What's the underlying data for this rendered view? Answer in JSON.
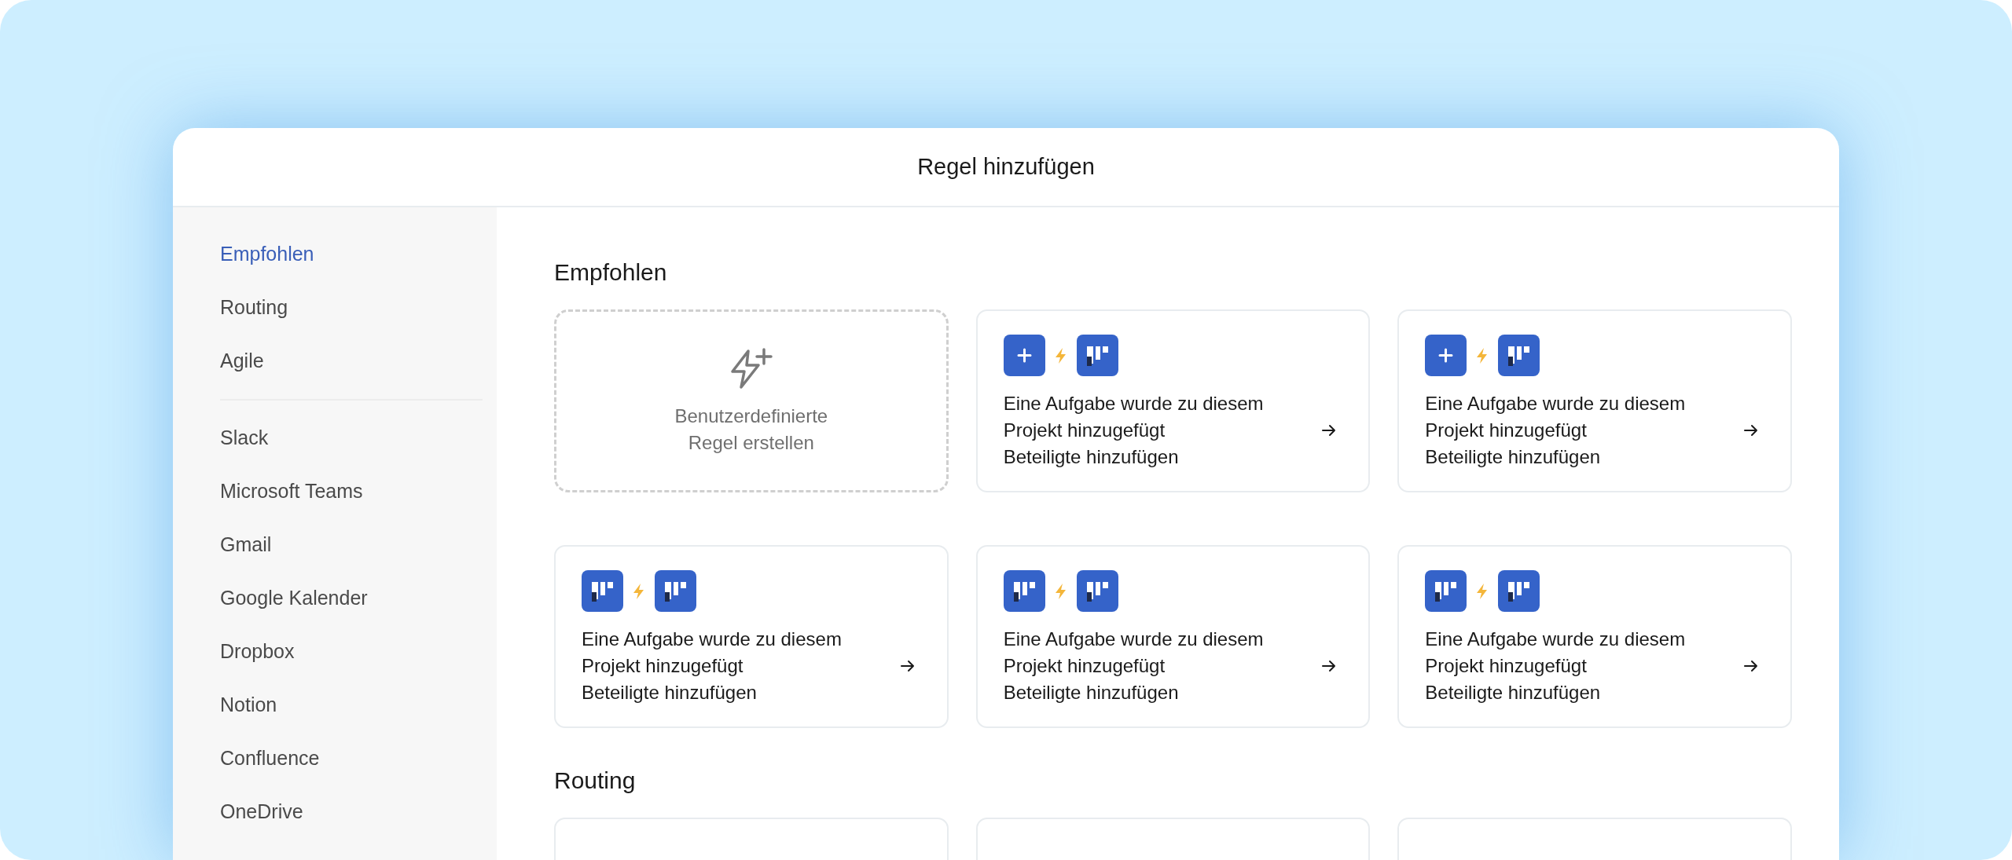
{
  "window": {
    "title": "Regel hinzufügen"
  },
  "sidebar": {
    "groups": [
      {
        "items": [
          {
            "label": "Empfohlen",
            "selected": true
          },
          {
            "label": "Routing",
            "selected": false
          },
          {
            "label": "Agile",
            "selected": false
          }
        ]
      },
      {
        "items": [
          {
            "label": "Slack",
            "selected": false
          },
          {
            "label": "Microsoft Teams",
            "selected": false
          },
          {
            "label": "Gmail",
            "selected": false
          },
          {
            "label": "Google Kalender",
            "selected": false
          },
          {
            "label": "Dropbox",
            "selected": false
          },
          {
            "label": "Notion",
            "selected": false
          },
          {
            "label": "Confluence",
            "selected": false
          },
          {
            "label": "OneDrive",
            "selected": false
          }
        ]
      }
    ]
  },
  "sections": [
    {
      "title": "Empfohlen",
      "cards": [
        {
          "kind": "custom",
          "lines": [
            "Benutzerdefinierte",
            "Regel erstellen"
          ]
        },
        {
          "kind": "rule",
          "icons": [
            {
              "kind": "plus"
            },
            {
              "kind": "board"
            }
          ],
          "lines": [
            "Eine Aufgabe wurde zu diesem",
            "Projekt hinzugefügt",
            "Beteiligte hinzufügen"
          ]
        },
        {
          "kind": "rule",
          "icons": [
            {
              "kind": "plus"
            },
            {
              "kind": "board"
            }
          ],
          "lines": [
            "Eine Aufgabe wurde zu diesem",
            "Projekt hinzugefügt",
            "Beteiligte hinzufügen"
          ]
        },
        {
          "kind": "rule",
          "icons": [
            {
              "kind": "board"
            },
            {
              "kind": "board"
            }
          ],
          "lines": [
            "Eine Aufgabe wurde zu diesem",
            "Projekt hinzugefügt",
            "Beteiligte hinzufügen"
          ]
        },
        {
          "kind": "rule",
          "icons": [
            {
              "kind": "board"
            },
            {
              "kind": "board"
            }
          ],
          "lines": [
            "Eine Aufgabe wurde zu diesem",
            "Projekt hinzugefügt",
            "Beteiligte hinzufügen"
          ]
        },
        {
          "kind": "rule",
          "icons": [
            {
              "kind": "board"
            },
            {
              "kind": "board"
            }
          ],
          "lines": [
            "Eine Aufgabe wurde zu diesem",
            "Projekt hinzugefügt",
            "Beteiligte hinzufügen"
          ]
        }
      ]
    },
    {
      "title": "Routing",
      "cards": [
        {
          "kind": "cut"
        },
        {
          "kind": "cut"
        },
        {
          "kind": "cut"
        }
      ]
    }
  ]
}
